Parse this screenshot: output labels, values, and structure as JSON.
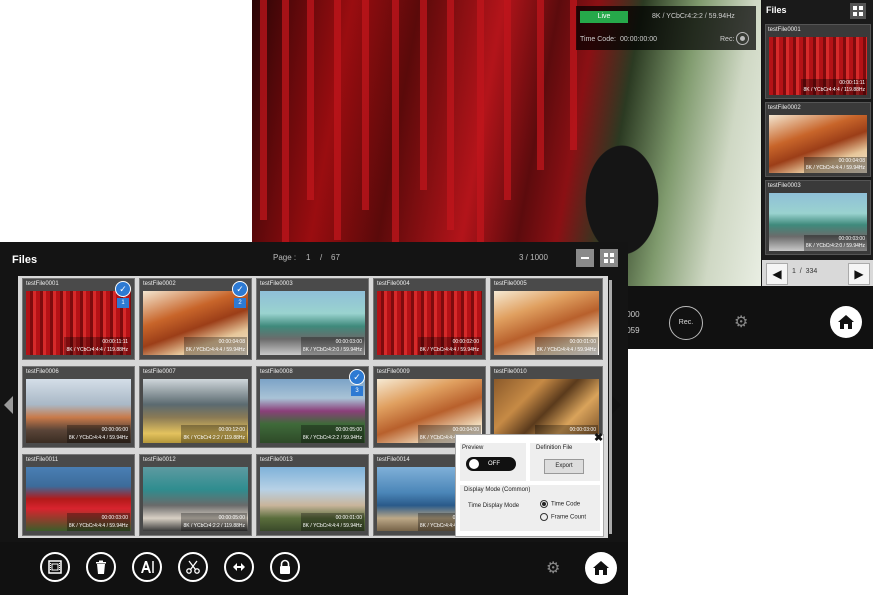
{
  "colors": {
    "live": "#26a84a",
    "check": "#2d7ad3",
    "window": "#141414",
    "gallery": "#d8d8d8"
  },
  "back_window": {
    "recording_overlay": {
      "live_label": "Live",
      "format": "8K / YCbCr4:2:2 / 59.94Hz",
      "time_code_label": "Time Code:",
      "time_code_value": "00:00:00:00",
      "rec_label": "Rec:"
    },
    "files_panel": {
      "title": "Files",
      "thumbnails": [
        {
          "label": "testFile0001",
          "tc": "00:00:11:11",
          "format": "8K / YCbCr4:4:4 / 119.88Hz",
          "palette": "p-red"
        },
        {
          "label": "testFile0002",
          "tc": "00:00:04:08",
          "format": "8K / YCbCr4:4:4 / 59.94Hz",
          "palette": "p-cake"
        },
        {
          "label": "testFile0003",
          "tc": "00:00:03:00",
          "format": "8K / YCbCr4:2:0 / 59.94Hz",
          "palette": "p-street"
        }
      ],
      "pager": {
        "current": "1",
        "separator": "/",
        "total": "334",
        "prev_icon": "arrow-left-icon",
        "next_icon": "arrow-right-icon"
      }
    },
    "toolbar": {
      "tc1": ":000",
      "tc2": ":059",
      "rec_button": "Rec.",
      "settings_icon": "gear-icon",
      "home_icon": "home-icon"
    }
  },
  "front_window": {
    "title": "Files",
    "page_label": "Page :",
    "page_current": "1",
    "page_separator": "/",
    "page_total": "67",
    "count": "3 / 1000",
    "thumbnails": [
      {
        "label": "testFile0001",
        "tc": "00:00:11:11",
        "format": "8K / YCbCr4:4:4 / 119.88Hz",
        "palette": "p-red",
        "checked": true,
        "order": "1"
      },
      {
        "label": "testFile0002",
        "tc": "00:00:04:08",
        "format": "8K / YCbCr4:4:4 / 59.94Hz",
        "palette": "p-cake",
        "checked": true,
        "order": "2"
      },
      {
        "label": "testFile0003",
        "tc": "00:00:03:00",
        "format": "8K / YCbCr4:2:0 / 59.94Hz",
        "palette": "p-street"
      },
      {
        "label": "testFile0004",
        "tc": "00:00:02:00",
        "format": "8K / YCbCr4:4:4 / 59.94Hz",
        "palette": "p-red"
      },
      {
        "label": "testFile0005",
        "tc": "00:00:01:00",
        "format": "8K / YCbCr4:4:4 / 59.94Hz",
        "palette": "p-dish"
      },
      {
        "label": "testFile0006",
        "tc": "00:00:06:00",
        "format": "8K / YCbCr4:4:4 / 59.94Hz",
        "palette": "p-temple"
      },
      {
        "label": "testFile0007",
        "tc": "00:00:12:00",
        "format": "8K / YCbCr4:2:2 / 119.88Hz",
        "palette": "p-shop"
      },
      {
        "label": "testFile0008",
        "tc": "00:00:05:00",
        "format": "8K / YCbCr4:2:2 / 59.94Hz",
        "palette": "p-garden",
        "checked": true,
        "order": "3"
      },
      {
        "label": "testFile0009",
        "tc": "00:00:04:00",
        "format": "8K / YCbCr4:4:4 / 59.94Hz",
        "palette": "p-dish"
      },
      {
        "label": "testFile0010",
        "tc": "00:00:03:00",
        "format": "8K / YCbCr4:4:4 / 59.94Hz",
        "palette": "p-leopard"
      },
      {
        "label": "testFile0011",
        "tc": "00:00:03:00",
        "format": "8K / YCbCr4:4:4 / 59.94Hz",
        "palette": "p-flowers"
      },
      {
        "label": "testFile0012",
        "tc": "00:00:05:00",
        "format": "8K / YCbCr4:2:2 / 119.88Hz",
        "palette": "p-crowd"
      },
      {
        "label": "testFile0013",
        "tc": "00:00:01:00",
        "format": "8K / YCbCr4:4:4 / 59.94Hz",
        "palette": "p-building"
      },
      {
        "label": "testFile0014",
        "tc": "00:00:01:00",
        "format": "8K / YCbCr4:4:4 / 59.94Hz",
        "palette": "p-sea"
      }
    ],
    "popup": {
      "preview_label": "Preview",
      "preview_toggle": "OFF",
      "definition_file_label": "Definition File",
      "export_button": "Export",
      "display_mode_label": "Display Mode (Common)",
      "time_display_mode_label": "Time Display Mode",
      "options": [
        "Time Code",
        "Frame Count"
      ],
      "selected_option": "Time Code"
    },
    "toolbar": {
      "buttons": [
        {
          "name": "film-icon"
        },
        {
          "name": "trash-icon"
        },
        {
          "name": "rename-icon"
        },
        {
          "name": "scissors-icon"
        },
        {
          "name": "sort-icon"
        },
        {
          "name": "lock-icon"
        }
      ],
      "settings_icon": "gear-icon",
      "home_icon": "home-icon"
    }
  }
}
